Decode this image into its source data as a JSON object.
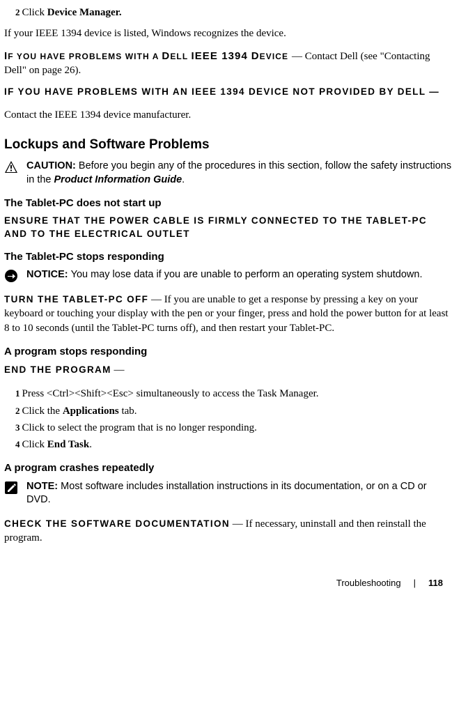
{
  "step2": {
    "num": "2",
    "prefix": "Click ",
    "bold": "Device Manager."
  },
  "line_ieee_listed": "If your IEEE 1394 device is listed, Windows recognizes the device.",
  "scDellDevice": {
    "pre": "I",
    "rest_sm": "F YOU HAVE PROBLEMS WITH A ",
    "mid_big": "D",
    "mid_sm": "ELL ",
    "iee": "IEEE 1394",
    "tail_sm_pre": " ",
    "tail_big": "D",
    "tail_sm": "EVICE",
    "follow": " —  Contact Dell (see \"Contacting Dell\" on page 26)."
  },
  "scNotDell": {
    "text": "IF YOU HAVE PROBLEMS WITH AN IEEE 1394 DEVICE NOT PROVIDED BY DELL —"
  },
  "contactMfr": "Contact the IEEE 1394 device manufacturer.",
  "h2_lockups": "Lockups and Software Problems",
  "caution": {
    "label": "CAUTION: ",
    "body_pre": "Before you begin any of the procedures in this section, follow the safety instructions in the ",
    "body_italic": "Product Information Guide",
    "body_post": "."
  },
  "h3_nostart": "The Tablet-PC does not start up",
  "ensure_line": "ENSURE THAT THE POWER CABLE IS FIRMLY CONNECTED TO THE TABLET-PC AND TO THE ELECTRICAL OUTLET",
  "h3_stops": "The Tablet-PC stops responding",
  "notice": {
    "label": "NOTICE: ",
    "body": "You may lose data if you are unable to perform an operating system shutdown."
  },
  "turnoff": {
    "heading": "TURN THE TABLET-PC OFF",
    "follow": " —  If you are unable to get a response by pressing a key on your keyboard or touching your display with the pen or your finger, press and hold the power button for at least 8 to 10 seconds (until the Tablet-PC turns off), and then restart your Tablet-PC."
  },
  "h3_progstops": "A program stops responding",
  "endprog": {
    "heading": "END THE PROGRAM",
    "dash": " —"
  },
  "steps_end": {
    "s1": {
      "n": "1",
      "t_pre": "Press <Ctrl><Shift><Esc> simultaneously to access the Task Manager."
    },
    "s2": {
      "n": "2",
      "t_pre": "Click the ",
      "bold": "Applications",
      "t_post": " tab."
    },
    "s3": {
      "n": "3",
      "t_pre": "Click to select the program that is no longer responding."
    },
    "s4": {
      "n": "4",
      "t_pre": "Click ",
      "bold": "End Task",
      "t_post": "."
    }
  },
  "h3_crashes": "A program crashes repeatedly",
  "note": {
    "label": "NOTE: ",
    "body": "Most software includes installation instructions in its documentation, or on a CD or DVD."
  },
  "checkdoc": {
    "heading": "CHECK THE SOFTWARE DOCUMENTATION",
    "follow": " —  If necessary, uninstall and then reinstall the program."
  },
  "footer": {
    "section": "Troubleshooting",
    "page": "118"
  }
}
